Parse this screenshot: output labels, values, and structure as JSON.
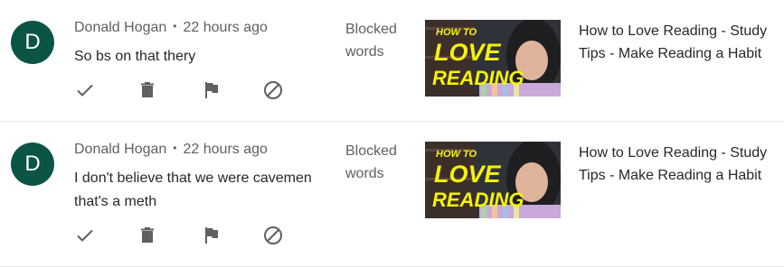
{
  "comments": [
    {
      "avatar_letter": "D",
      "author": "Donald Hogan",
      "separator": "•",
      "time": "22 hours ago",
      "text": "So bs on that thery",
      "status_line1": "Blocked",
      "status_line2": "words",
      "video_title": "How to Love Reading  - Study Tips - Make Reading a Habit",
      "thumbnail": {
        "top": "HOW TO",
        "mid": "LOVE",
        "bottom": "READING"
      }
    },
    {
      "avatar_letter": "D",
      "author": "Donald Hogan",
      "separator": "•",
      "time": "22 hours ago",
      "text": "I don't believe that we were cavemen that's a meth",
      "status_line1": "Blocked",
      "status_line2": "words",
      "video_title": "How to Love Reading  - Study Tips - Make Reading a Habit",
      "thumbnail": {
        "top": "HOW TO",
        "mid": "LOVE",
        "bottom": "READING"
      }
    }
  ],
  "icons": [
    "check-icon",
    "trash-icon",
    "flag-icon",
    "block-icon"
  ],
  "colors": {
    "avatar_bg": "#0a5545",
    "thumb_text": "#f5f20a",
    "muted_text": "#606060"
  }
}
